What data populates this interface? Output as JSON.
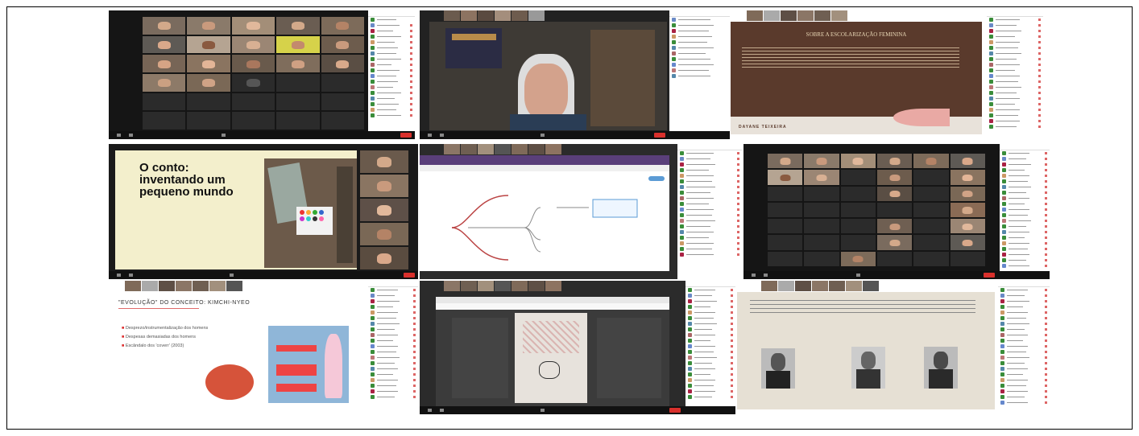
{
  "collage": {
    "description_tiles": 9,
    "tile1": {
      "label": "Zoom gallery view"
    },
    "tile3": {
      "slide_title": "SOBRE A ESCOLARIZAÇÃO FEMININA",
      "slide_author": "DAYANE TEIXEIRA"
    },
    "tile4": {
      "slide_title": "O conto:\ninventando um\npequeno mundo"
    },
    "tile7": {
      "slide_title": "\"EVOLUÇÃO\" DO CONCEITO: KIMCHI-NYEO",
      "bullets": [
        "Desprezo/instrumentalização dos homens",
        "Despesas demasiadas dos homens",
        "Escândalo dos 'coverr' (2003)"
      ]
    },
    "tile9": {
      "label": "Slide with three portraits"
    }
  },
  "colors": {
    "zoom_bg": "#1d1d1d",
    "end_button": "#d9302c",
    "green": "#3a8d3a",
    "slide_cream": "#f3efcc"
  },
  "icons": [
    "video-icon",
    "mic-icon",
    "share-icon",
    "end-call-icon"
  ]
}
